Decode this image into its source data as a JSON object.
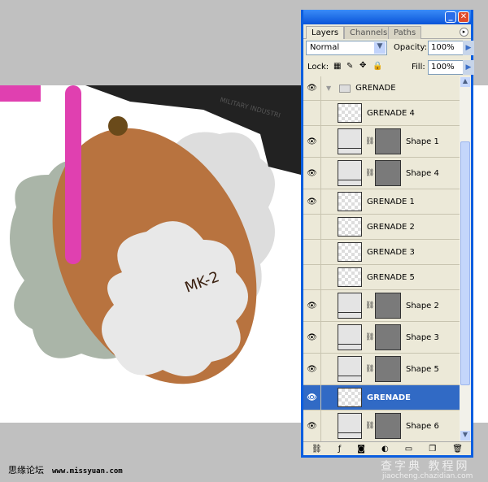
{
  "panel": {
    "tabs": [
      "Layers",
      "Channels",
      "Paths"
    ],
    "blend_mode": "Normal",
    "opacity_label": "Opacity:",
    "opacity": "100%",
    "lock_label": "Lock:",
    "fill_label": "Fill:",
    "fill": "100%"
  },
  "layers": [
    {
      "name": "GRENADE",
      "type": "group",
      "visible": true
    },
    {
      "name": "GRENADE 4",
      "type": "pixel",
      "visible": false
    },
    {
      "name": "Shape 1",
      "type": "shape",
      "visible": true
    },
    {
      "name": "Shape 4",
      "type": "shape",
      "visible": true
    },
    {
      "name": "GRENADE 1",
      "type": "pixel",
      "visible": true
    },
    {
      "name": "GRENADE 2",
      "type": "pixel",
      "visible": false
    },
    {
      "name": "GRENADE 3",
      "type": "pixel",
      "visible": false
    },
    {
      "name": "GRENADE 5",
      "type": "pixel",
      "visible": false
    },
    {
      "name": "Shape 2",
      "type": "shape",
      "visible": true
    },
    {
      "name": "Shape 3",
      "type": "shape",
      "visible": true
    },
    {
      "name": "Shape 5",
      "type": "shape",
      "visible": true
    },
    {
      "name": "GRENADE",
      "type": "pixel",
      "visible": true,
      "selected": true
    },
    {
      "name": "Shape 6",
      "type": "shape",
      "visible": true
    }
  ],
  "artwork": {
    "engraving": "MK-2",
    "gun_text": "MILITARY INDUSTRI"
  },
  "footer": {
    "forum": "思缘论坛",
    "site": "www.missyuan.com"
  },
  "watermark": {
    "title": "查字典 教程网",
    "url": "jiaocheng.chazidian.com"
  },
  "colors": {
    "selection": "#316ac5",
    "titlebar": "#0a54d8",
    "copper": "#b8733f",
    "pink": "#e040b0",
    "cloud": "#aab5a8"
  }
}
